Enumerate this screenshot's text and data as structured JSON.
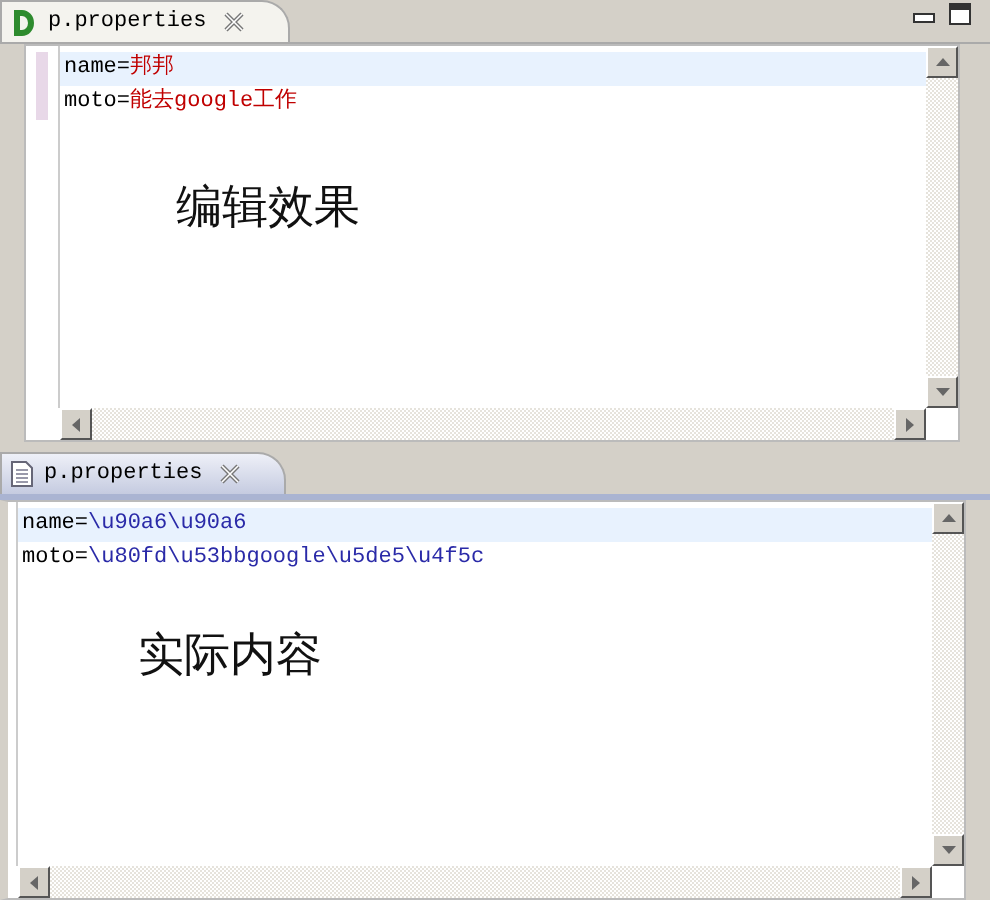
{
  "panes": [
    {
      "kind": "rendered",
      "active": false,
      "window_controls": true,
      "tab": {
        "label": "p.properties"
      },
      "lines": [
        {
          "key": "name",
          "sep": "=",
          "value": "邦邦",
          "highlighted": true,
          "changed": true
        },
        {
          "key": "moto",
          "sep": "=",
          "value": "能去google工作",
          "highlighted": false,
          "changed": true
        }
      ],
      "caption": "编辑效果"
    },
    {
      "kind": "escaped",
      "active": true,
      "window_controls": false,
      "tab": {
        "label": "p.properties"
      },
      "lines": [
        {
          "key": "name",
          "sep": "=",
          "value": "\\u90a6\\u90a6",
          "highlighted": true,
          "changed": false
        },
        {
          "key": "moto",
          "sep": "=",
          "value": "\\u80fd\\u53bbgoogle\\u5de5\\u4f5c",
          "highlighted": false,
          "changed": false
        }
      ],
      "caption": "实际内容"
    }
  ]
}
